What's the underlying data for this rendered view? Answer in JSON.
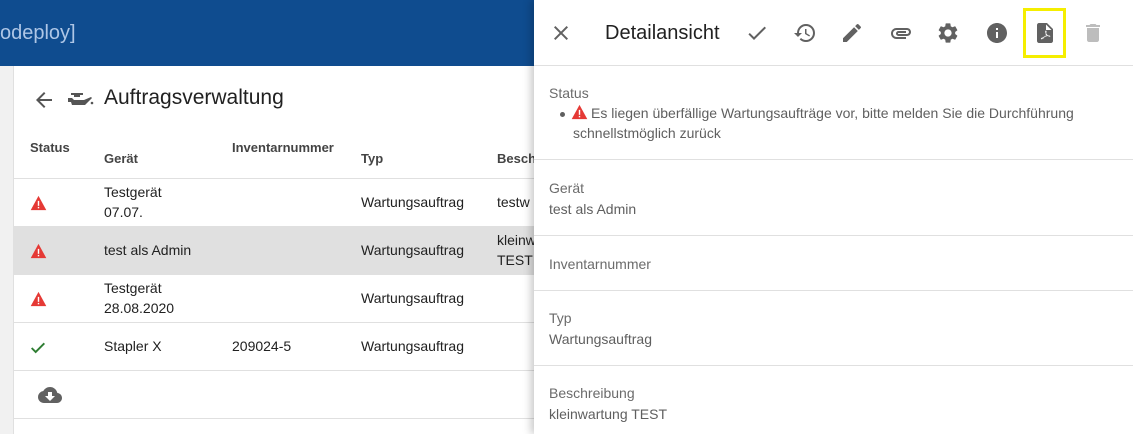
{
  "app": {
    "title": "odeploy]"
  },
  "page": {
    "title": "Auftragsverwaltung"
  },
  "table": {
    "headers": {
      "status": "Status",
      "geraet": "Gerät",
      "inventar": "Inventarnummer",
      "typ": "Typ",
      "beschreibung": "Beschr"
    },
    "rows": [
      {
        "status": "warning",
        "geraet_l1": "Testgerät",
        "geraet_l2": "07.07.",
        "inventar": "",
        "typ": "Wartungsauftrag",
        "beschr_l1": "testw",
        "beschr_l2": ""
      },
      {
        "status": "warning",
        "geraet_l1": "test als Admin",
        "geraet_l2": "",
        "inventar": "",
        "typ": "Wartungsauftrag",
        "beschr_l1": "kleinw",
        "beschr_l2": "TEST"
      },
      {
        "status": "warning",
        "geraet_l1": "Testgerät",
        "geraet_l2": "28.08.2020",
        "inventar": "",
        "typ": "Wartungsauftrag",
        "beschr_l1": "",
        "beschr_l2": ""
      },
      {
        "status": "ok",
        "geraet_l1": "Stapler X",
        "geraet_l2": "",
        "inventar": "209024-5",
        "typ": "Wartungsauftrag",
        "beschr_l1": "",
        "beschr_l2": ""
      }
    ]
  },
  "detail": {
    "title": "Detailansicht",
    "toolbar_icons": [
      "close-icon",
      "check-icon",
      "history-icon",
      "edit-icon",
      "attachment-icon",
      "settings-icon",
      "info-icon",
      "pdf-icon",
      "delete-icon"
    ],
    "status_label": "Status",
    "status_message_l1": "Es liegen überfällige Wartungsaufträge vor, bitte melden Sie die Durchführung",
    "status_message_l2": "schnellstmöglich zurück",
    "geraet_label": "Gerät",
    "geraet_value": "test als Admin",
    "inventar_label": "Inventarnummer",
    "inventar_value": "",
    "typ_label": "Typ",
    "typ_value": "Wartungsauftrag",
    "beschreibung_label": "Beschreibung",
    "beschreibung_value": "kleinwartung TEST"
  },
  "colors": {
    "appbar": "#0f4c8f",
    "warning": "#e53935",
    "ok": "#2e7d32",
    "highlight": "#f5ee00",
    "selected_row": "#e0e0e0"
  }
}
